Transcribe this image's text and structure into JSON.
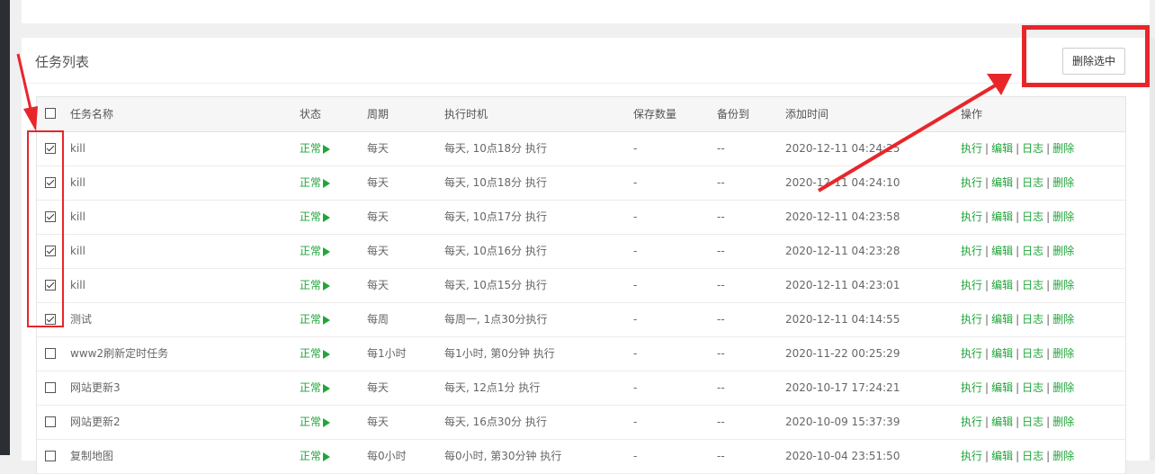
{
  "panel": {
    "title": "任务列表",
    "delete_selected_label": "删除选中"
  },
  "table": {
    "headers": {
      "name": "任务名称",
      "status": "状态",
      "cycle": "周期",
      "exec_time": "执行时机",
      "keep_count": "保存数量",
      "backup_to": "备份到",
      "add_time": "添加时间",
      "ops": "操作"
    },
    "ops_labels": {
      "run": "执行",
      "edit": "编辑",
      "log": "日志",
      "delete": "删除"
    },
    "rows": [
      {
        "checked": true,
        "name": "kill",
        "status": "正常",
        "cycle": "每天",
        "exec_time": "每天, 10点18分 执行",
        "keep_count": "-",
        "backup_to": "--",
        "add_time": "2020-12-11 04:24:25"
      },
      {
        "checked": true,
        "name": "kill",
        "status": "正常",
        "cycle": "每天",
        "exec_time": "每天, 10点18分 执行",
        "keep_count": "-",
        "backup_to": "--",
        "add_time": "2020-12-11 04:24:10"
      },
      {
        "checked": true,
        "name": "kill",
        "status": "正常",
        "cycle": "每天",
        "exec_time": "每天, 10点17分 执行",
        "keep_count": "-",
        "backup_to": "--",
        "add_time": "2020-12-11 04:23:58"
      },
      {
        "checked": true,
        "name": "kill",
        "status": "正常",
        "cycle": "每天",
        "exec_time": "每天, 10点16分 执行",
        "keep_count": "-",
        "backup_to": "--",
        "add_time": "2020-12-11 04:23:28"
      },
      {
        "checked": true,
        "name": "kill",
        "status": "正常",
        "cycle": "每天",
        "exec_time": "每天, 10点15分 执行",
        "keep_count": "-",
        "backup_to": "--",
        "add_time": "2020-12-11 04:23:01"
      },
      {
        "checked": true,
        "name": "测试",
        "status": "正常",
        "cycle": "每周",
        "exec_time": "每周一, 1点30分执行",
        "keep_count": "-",
        "backup_to": "--",
        "add_time": "2020-12-11 04:14:55"
      },
      {
        "checked": false,
        "name": "www2刷新定时任务",
        "status": "正常",
        "cycle": "每1小时",
        "exec_time": "每1小时, 第0分钟 执行",
        "keep_count": "-",
        "backup_to": "--",
        "add_time": "2020-11-22 00:25:29"
      },
      {
        "checked": false,
        "name": "网站更新3",
        "status": "正常",
        "cycle": "每天",
        "exec_time": "每天, 12点1分 执行",
        "keep_count": "-",
        "backup_to": "--",
        "add_time": "2020-10-17 17:24:21"
      },
      {
        "checked": false,
        "name": "网站更新2",
        "status": "正常",
        "cycle": "每天",
        "exec_time": "每天, 16点30分 执行",
        "keep_count": "-",
        "backup_to": "--",
        "add_time": "2020-10-09 15:37:39"
      },
      {
        "checked": false,
        "name": "复制地图",
        "status": "正常",
        "cycle": "每0小时",
        "exec_time": "每0小时, 第30分钟 执行",
        "keep_count": "-",
        "backup_to": "--",
        "add_time": "2020-10-04 23:51:50"
      }
    ]
  },
  "colors": {
    "accent_green": "#20a53a",
    "annotation_red": "#e8262a"
  }
}
